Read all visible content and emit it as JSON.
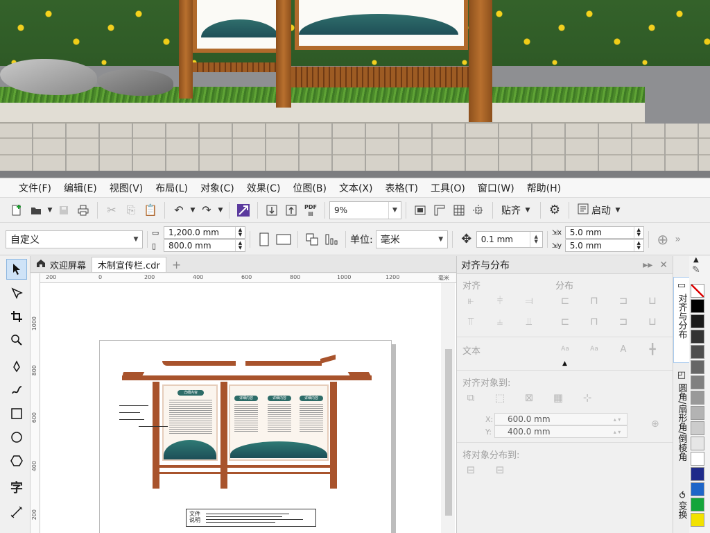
{
  "menu": [
    "文件(F)",
    "编辑(E)",
    "视图(V)",
    "布局(L)",
    "对象(C)",
    "效果(C)",
    "位图(B)",
    "文本(X)",
    "表格(T)",
    "工具(O)",
    "窗口(W)",
    "帮助(H)"
  ],
  "toolbar": {
    "zoom": "9%",
    "snap_label": "贴齐",
    "launch_label": "启动",
    "pdf_label": "PDF"
  },
  "property_bar": {
    "preset": "自定义",
    "width": "1,200.0 mm",
    "height": "800.0 mm",
    "units_label": "单位:",
    "units_value": "毫米",
    "nudge": "0.1 mm",
    "dup_x": "5.0 mm",
    "dup_y": "5.0 mm"
  },
  "tabs": {
    "welcome": "欢迎屏幕",
    "document": "木制宣传栏.cdr",
    "add": "+"
  },
  "ruler": {
    "h_ticks": [
      "200",
      "0",
      "200",
      "400",
      "600",
      "800",
      "1000",
      "1200"
    ],
    "h_unit": "毫米",
    "v_ticks": [
      "1000",
      "800",
      "600",
      "400",
      "200"
    ]
  },
  "artwork": {
    "panel1_title": "详细内容",
    "panel2_titles": [
      "详细内容",
      "详细内容",
      "详细内容"
    ],
    "legend_line1": "文件",
    "legend_line2": "说明"
  },
  "docker": {
    "title": "对齐与分布",
    "align_section": "对齐",
    "distribute_section": "分布",
    "text_section": "文本",
    "align_to_section": "对齐对象到:",
    "x_label": "X:",
    "x_value": "600.0 mm",
    "y_label": "Y:",
    "y_value": "400.0 mm",
    "distribute_to_section": "将对象分布到:"
  },
  "vtabs": [
    "对齐与分布",
    "圆角/扇形角/倒棱角",
    "变换"
  ],
  "palette": [
    "#ffffff",
    "#000000",
    "#1a1a1a",
    "#333333",
    "#4d4d4d",
    "#666666",
    "#808080",
    "#999999",
    "#b3b3b3",
    "#cccccc",
    "#e6e6e6",
    "#ffffff",
    "#1f2a8a",
    "#1e66c8",
    "#14a53a",
    "#f2e200"
  ]
}
